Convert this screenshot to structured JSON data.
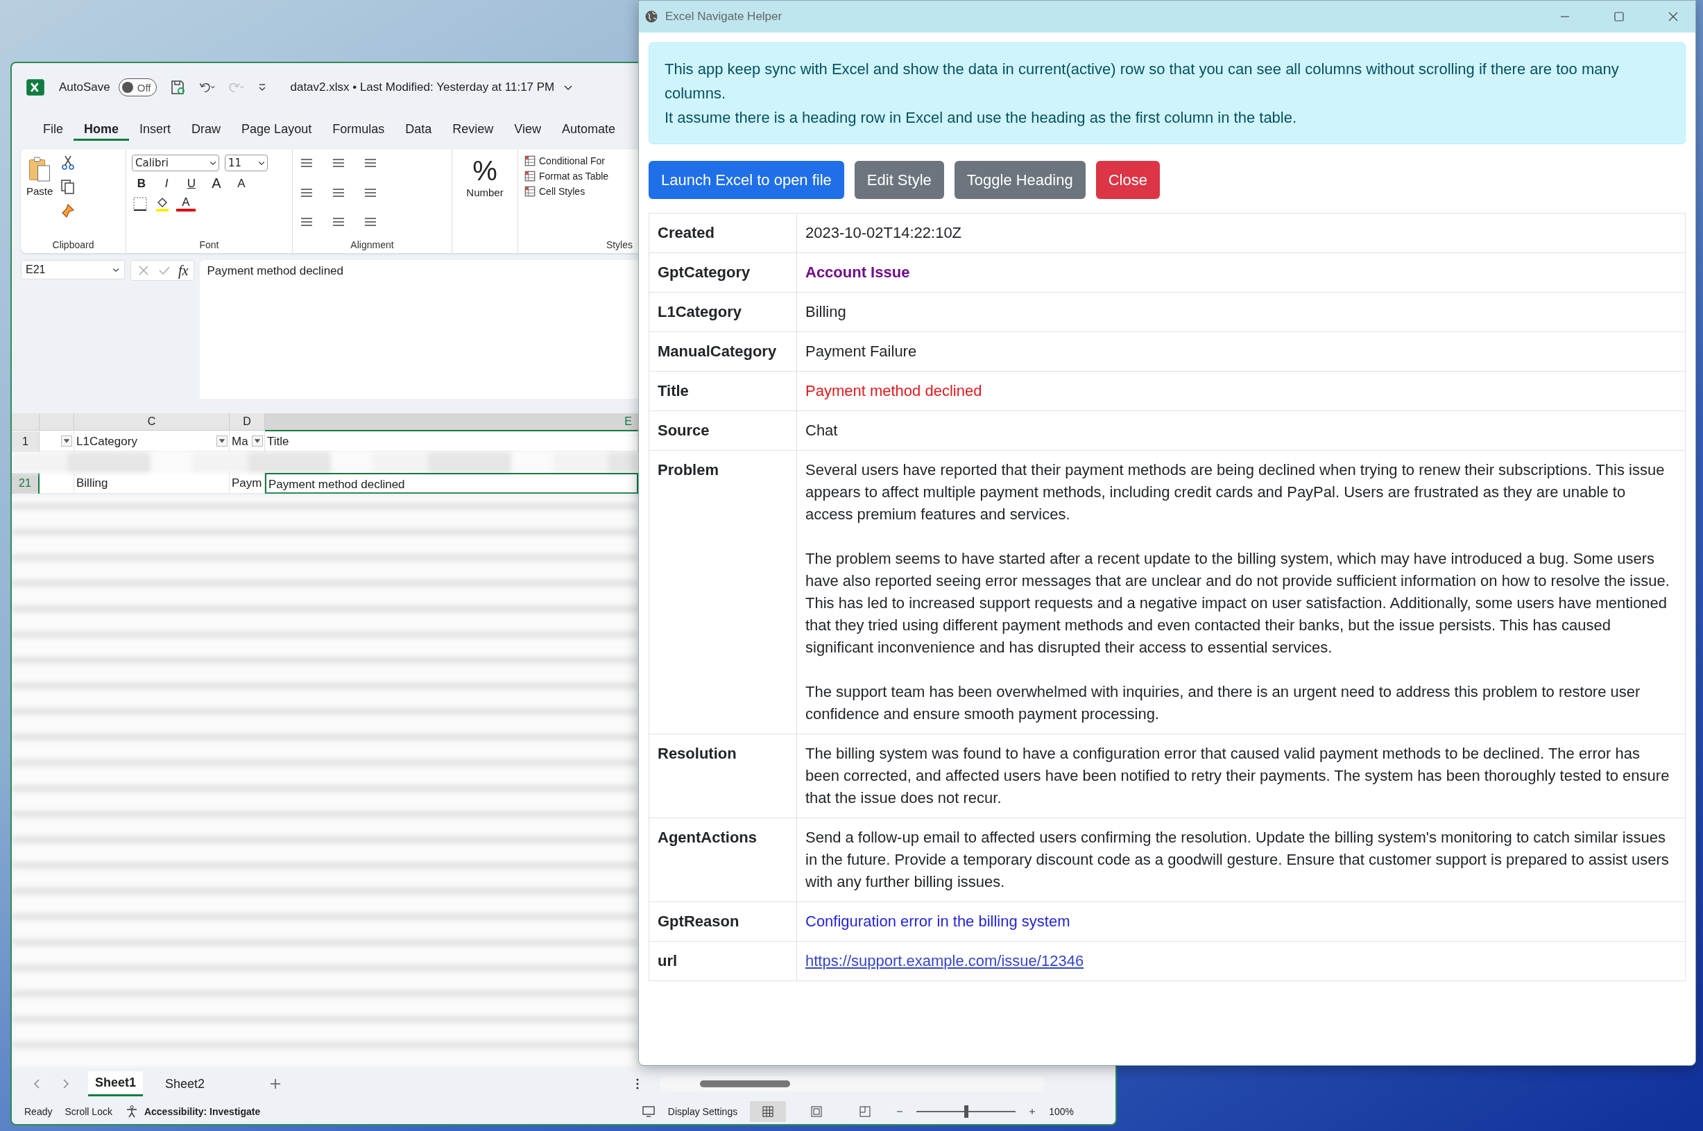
{
  "excel": {
    "title_bar": {
      "autosave_label": "AutoSave",
      "autosave_on": false,
      "autosave_state": "Off",
      "file_title": "datav2.xlsx • Last Modified: Yesterday at 11:17 PM"
    },
    "menu_tabs": [
      {
        "label": "File",
        "selected": false
      },
      {
        "label": "Home",
        "selected": true
      },
      {
        "label": "Insert",
        "selected": false
      },
      {
        "label": "Draw",
        "selected": false
      },
      {
        "label": "Page Layout",
        "selected": false
      },
      {
        "label": "Formulas",
        "selected": false
      },
      {
        "label": "Data",
        "selected": false
      },
      {
        "label": "Review",
        "selected": false
      },
      {
        "label": "View",
        "selected": false
      },
      {
        "label": "Automate",
        "selected": false
      }
    ],
    "ribbon": {
      "clipboard": {
        "paste": "Paste",
        "group": "Clipboard"
      },
      "font": {
        "name": "Calibri",
        "size": "11",
        "bold": "B",
        "italic": "I",
        "underline": "U",
        "grow": "A",
        "shrink": "A",
        "fontcolor_letter": "A",
        "group": "Font"
      },
      "alignment": {
        "group": "Alignment"
      },
      "number": {
        "label": "Number",
        "symbol": "%"
      },
      "styles": {
        "items": [
          "Conditional For",
          "Format as Table",
          "Cell Styles"
        ],
        "group": "Styles"
      }
    },
    "formula_bar": {
      "name_box": "E21",
      "fx": "fx",
      "value": "Payment method declined"
    },
    "grid": {
      "columns": [
        {
          "label": "C",
          "selected": false
        },
        {
          "label": "D",
          "selected": false
        },
        {
          "label": "E",
          "selected": true
        }
      ],
      "rows": [
        {
          "number": "1",
          "selected": false,
          "cells": [
            "L1Category",
            "Ma",
            "Title"
          ]
        },
        {
          "number": "21",
          "selected": true,
          "cells": [
            "Billing",
            "Paym",
            "Payment method declined"
          ]
        }
      ]
    },
    "sheet_tabs": [
      {
        "label": "Sheet1",
        "selected": true
      },
      {
        "label": "Sheet2",
        "selected": false
      }
    ],
    "status_bar": {
      "ready": "Ready",
      "scroll_lock": "Scroll Lock",
      "accessibility": "Accessibility: Investigate",
      "display_settings": "Display Settings",
      "views": [
        {
          "kind": "normal",
          "selected": true
        },
        {
          "kind": "page-layout",
          "selected": false
        },
        {
          "kind": "page-break",
          "selected": false
        }
      ],
      "zoom": {
        "level": 0.5,
        "reading": "100%"
      }
    }
  },
  "helper": {
    "title": "Excel Navigate Helper",
    "info": [
      "This app keep sync with Excel and show the data in current(active) row so that you can see all columns without scrolling if there are too many columns.",
      "It assume there is a heading row in Excel and use the heading as the first column in the table."
    ],
    "buttons": [
      {
        "label": "Launch Excel to open file",
        "kind": "primary"
      },
      {
        "label": "Edit Style",
        "kind": "secondary"
      },
      {
        "label": "Toggle Heading",
        "kind": "secondary"
      },
      {
        "label": "Close",
        "kind": "danger"
      }
    ],
    "fields": [
      {
        "name": "Created",
        "kind": "plain",
        "value": [
          "2023-10-02T14:22:10Z"
        ]
      },
      {
        "name": "GptCategory",
        "kind": "category",
        "value": [
          "Account Issue"
        ]
      },
      {
        "name": "L1Category",
        "kind": "plain",
        "value": [
          "Billing"
        ]
      },
      {
        "name": "ManualCategory",
        "kind": "plain",
        "value": [
          "Payment Failure"
        ]
      },
      {
        "name": "Title",
        "kind": "alert",
        "value": [
          "Payment method declined"
        ]
      },
      {
        "name": "Source",
        "kind": "plain",
        "value": [
          "Chat"
        ]
      },
      {
        "name": "Problem",
        "kind": "plain",
        "value": [
          "Several users have reported that their payment methods are being declined when trying to renew their subscriptions. This issue appears to affect multiple payment methods, including credit cards and PayPal. Users are frustrated as they are unable to access premium features and services.",
          "The problem seems to have started after a recent update to the billing system, which may have introduced a bug. Some users have also reported seeing error messages that are unclear and do not provide sufficient information on how to resolve the issue. This has led to increased support requests and a negative impact on user satisfaction. Additionally, some users have mentioned that they tried using different payment methods and even contacted their banks, but the issue persists. This has caused significant inconvenience and has disrupted their access to essential services.",
          "The support team has been overwhelmed with inquiries, and there is an urgent need to address this problem to restore user confidence and ensure smooth payment processing."
        ]
      },
      {
        "name": "Resolution",
        "kind": "plain",
        "value": [
          "The billing system was found to have a configuration error that caused valid payment methods to be declined. The error has been corrected, and affected users have been notified to retry their payments. The system has been thoroughly tested to ensure that the issue does not recur."
        ]
      },
      {
        "name": "AgentActions",
        "kind": "plain",
        "value": [
          "Send a follow-up email to affected users confirming the resolution. Update the billing system's monitoring to catch similar issues in the future. Provide a temporary discount code as a goodwill gesture. Ensure that customer support is prepared to assist users with any further billing issues."
        ]
      },
      {
        "name": "GptReason",
        "kind": "reason",
        "value": [
          "Configuration error in the billing system"
        ]
      },
      {
        "name": "url",
        "kind": "link",
        "value": [
          "https://support.example.com/issue/12346"
        ]
      }
    ]
  }
}
